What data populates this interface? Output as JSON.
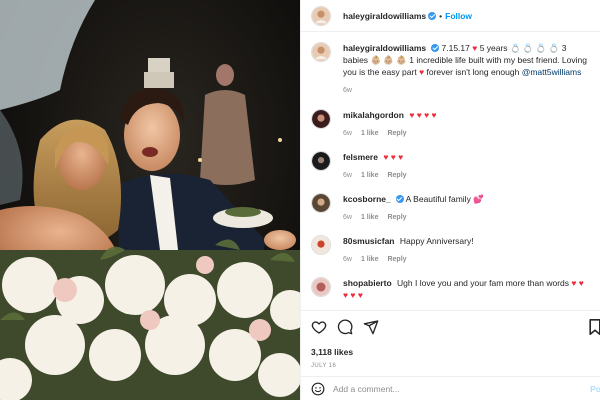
{
  "header": {
    "username": "haleygiraldowilliams",
    "separator": "•",
    "follow_label": "Follow"
  },
  "caption": {
    "username": "haleygiraldowilliams",
    "segments": {
      "a": "7.15.17",
      "heart1": "♥",
      "b": "5 years",
      "rings": "💍 💍 💍 💍",
      "c": "3 babies",
      "babies": "👶🏼 👶🏼 👶🏼",
      "d": "1 incredible life built with my best friend. Loving you is the easy part",
      "heart2": "♥",
      "e": "forever isn't long enough",
      "mention": "@matt5williams"
    },
    "time": "6w"
  },
  "comments": [
    {
      "username": "mikalahgordon",
      "verified": false,
      "text": "",
      "hearts": "♥ ♥ ♥ ♥",
      "time": "6w",
      "likes": "1 like",
      "reply": "Reply"
    },
    {
      "username": "felsmere",
      "verified": false,
      "text": "",
      "hearts": "♥ ♥ ♥",
      "time": "6w",
      "likes": "1 like",
      "reply": "Reply"
    },
    {
      "username": "kcosborne_",
      "verified": true,
      "text": "A Beautiful family",
      "hearts": "💕",
      "time": "6w",
      "likes": "1 like",
      "reply": "Reply"
    },
    {
      "username": "80smusicfan",
      "verified": false,
      "text": "Happy Anniversary!",
      "hearts": "",
      "time": "6w",
      "likes": "1 like",
      "reply": "Reply"
    },
    {
      "username": "shopabierto",
      "verified": false,
      "text": "Ugh I love you and your fam more than words",
      "hearts": "♥ ♥ ♥ ♥ ♥",
      "time": "",
      "likes": "",
      "reply": ""
    }
  ],
  "actions": {
    "likes_text": "3,118 likes",
    "date": "JULY 16",
    "comment_placeholder": "Add a comment...",
    "post_label": "Po"
  },
  "colors": {
    "accent": "#0095f6",
    "verified": "#3897f0",
    "heart": "#ed2e3b",
    "muted": "#8e8e8e"
  },
  "icons": [
    "heart-icon",
    "comment-icon",
    "share-icon",
    "bookmark-icon",
    "verified-badge-icon"
  ]
}
